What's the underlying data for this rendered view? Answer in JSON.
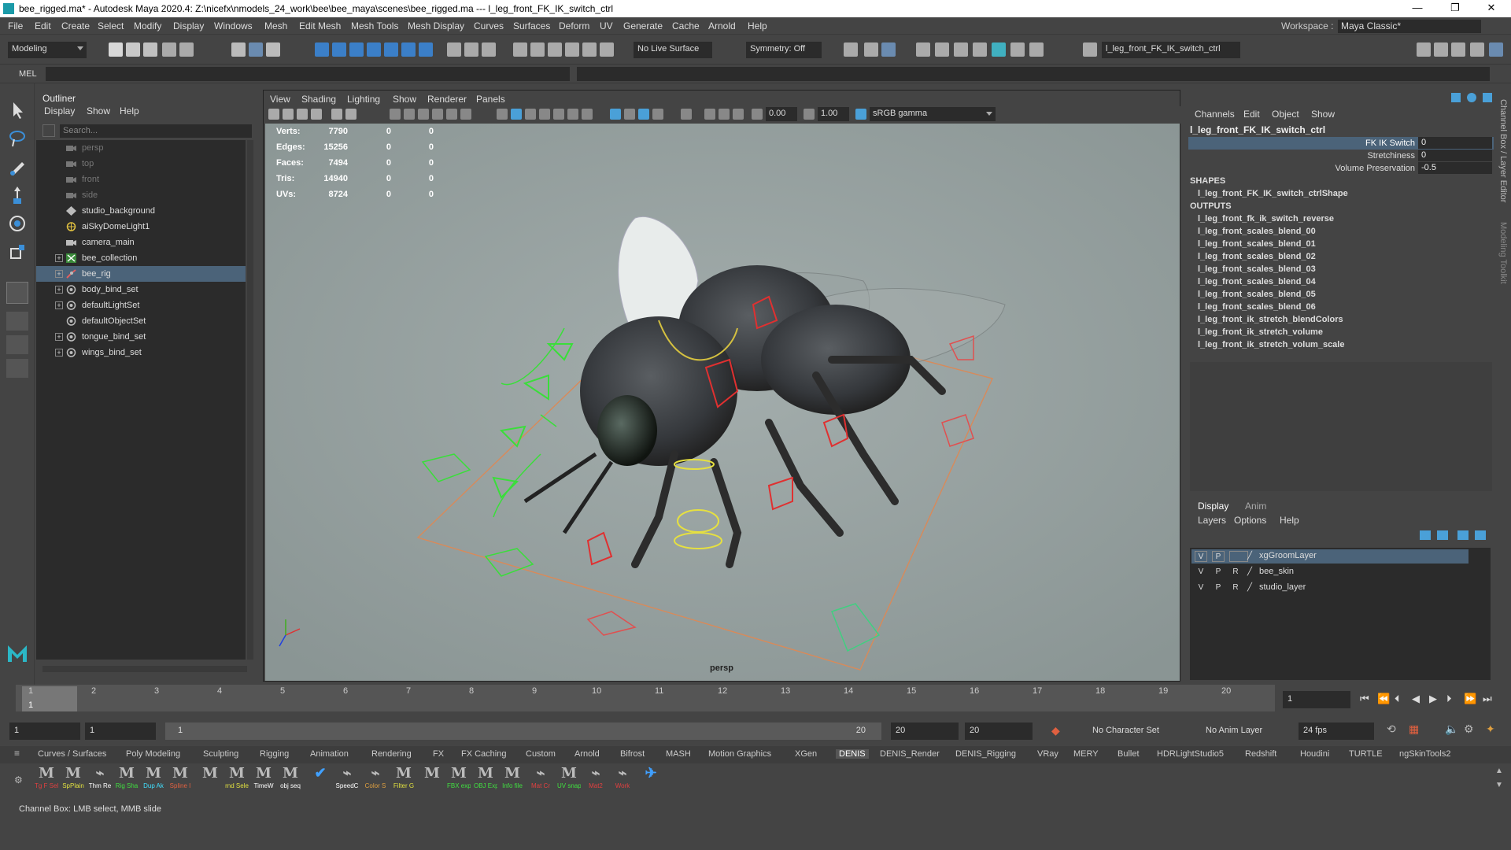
{
  "window": {
    "title": "bee_rigged.ma* - Autodesk Maya 2020.4: Z:\\nicefx\\nmodels_24_work\\bee\\bee_maya\\scenes\\bee_rigged.ma   ---   l_leg_front_FK_IK_switch_ctrl",
    "minimize": "—",
    "restore": "❐",
    "close": "✕"
  },
  "menubar": {
    "items": [
      "File",
      "Edit",
      "Create",
      "Select",
      "Modify",
      "Display",
      "Windows",
      "Mesh",
      "Edit Mesh",
      "Mesh Tools",
      "Mesh Display",
      "Curves",
      "Surfaces",
      "Deform",
      "UV",
      "Generate",
      "Cache",
      "Arnold",
      "Help"
    ],
    "workspace_label": "Workspace :",
    "workspace_value": "Maya Classic*"
  },
  "statusline": {
    "mode": "Modeling",
    "live_surface": "No Live Surface",
    "symmetry": "Symmetry: Off",
    "selected_object": "l_leg_front_FK_IK_switch_ctrl"
  },
  "commandline": {
    "label": "MEL"
  },
  "outliner": {
    "title": "Outliner",
    "menus": [
      "Display",
      "Show",
      "Help"
    ],
    "search_placeholder": "Search...",
    "items": [
      {
        "label": "persp",
        "kind": "camera",
        "expandable": false
      },
      {
        "label": "top",
        "kind": "camera",
        "expandable": false
      },
      {
        "label": "front",
        "kind": "camera",
        "expandable": false
      },
      {
        "label": "side",
        "kind": "camera",
        "expandable": false
      },
      {
        "label": "studio_background",
        "kind": "transform",
        "expandable": false
      },
      {
        "label": "aiSkyDomeLight1",
        "kind": "light",
        "expandable": false
      },
      {
        "label": "camera_main",
        "kind": "camera-main",
        "expandable": false
      },
      {
        "label": "bee_collection",
        "kind": "group",
        "expandable": true
      },
      {
        "label": "bee_rig",
        "kind": "rig",
        "expandable": true,
        "selected": true
      },
      {
        "label": "body_bind_set",
        "kind": "set",
        "expandable": true
      },
      {
        "label": "defaultLightSet",
        "kind": "set",
        "expandable": true
      },
      {
        "label": "defaultObjectSet",
        "kind": "set",
        "expandable": false
      },
      {
        "label": "tongue_bind_set",
        "kind": "set",
        "expandable": true
      },
      {
        "label": "wings_bind_set",
        "kind": "set",
        "expandable": true
      }
    ]
  },
  "viewport": {
    "menus": [
      "View",
      "Shading",
      "Lighting",
      "Show",
      "Renderer",
      "Panels"
    ],
    "exposure": "0.00",
    "gamma": "1.00",
    "color_space": "sRGB gamma",
    "camera_label": "persp",
    "stats": [
      {
        "label": "Verts:",
        "values": [
          "7790",
          "0",
          "0"
        ]
      },
      {
        "label": "Edges:",
        "values": [
          "15256",
          "0",
          "0"
        ]
      },
      {
        "label": "Faces:",
        "values": [
          "7494",
          "0",
          "0"
        ]
      },
      {
        "label": "Tris:",
        "values": [
          "14940",
          "0",
          "0"
        ]
      },
      {
        "label": "UVs:",
        "values": [
          "8724",
          "0",
          "0"
        ]
      }
    ]
  },
  "channelbox": {
    "menus": [
      "Channels",
      "Edit",
      "Object",
      "Show"
    ],
    "object": "l_leg_front_FK_IK_switch_ctrl",
    "attributes": [
      {
        "name": "FK IK Switch",
        "value": "0"
      },
      {
        "name": "Stretchiness",
        "value": "0"
      },
      {
        "name": "Volume Preservation",
        "value": "-0.5"
      }
    ],
    "shapes_header": "SHAPES",
    "shape": "l_leg_front_FK_IK_switch_ctrlShape",
    "outputs_header": "OUTPUTS",
    "outputs": [
      "l_leg_front_fk_ik_switch_reverse",
      "l_leg_front_scales_blend_00",
      "l_leg_front_scales_blend_01",
      "l_leg_front_scales_blend_02",
      "l_leg_front_scales_blend_03",
      "l_leg_front_scales_blend_04",
      "l_leg_front_scales_blend_05",
      "l_leg_front_scales_blend_06",
      "l_leg_front_ik_stretch_blendColors",
      "l_leg_front_ik_stretch_volume",
      "l_leg_front_ik_stretch_volum_scale"
    ]
  },
  "rightstrip": {
    "label1": "Channel Box / Layer Editor",
    "label2": "Modeling Toolkit"
  },
  "layers": {
    "tabs": [
      "Display",
      "Anim"
    ],
    "menus": [
      "Layers",
      "Options",
      "Help"
    ],
    "items": [
      {
        "v": "V",
        "p": "P",
        "r": "",
        "name": "xgGroomLayer",
        "selected": true
      },
      {
        "v": "V",
        "p": "P",
        "r": "R",
        "name": "bee_skin",
        "selected": false
      },
      {
        "v": "V",
        "p": "P",
        "r": "R",
        "name": "studio_layer",
        "selected": false
      }
    ]
  },
  "timeline": {
    "ticks": [
      "1",
      "2",
      "3",
      "4",
      "5",
      "6",
      "7",
      "8",
      "9",
      "10",
      "11",
      "12",
      "13",
      "14",
      "15",
      "16",
      "17",
      "18",
      "19",
      "20"
    ],
    "current_frame_label": "1",
    "current_frame_field": "1"
  },
  "range": {
    "start": "1",
    "playback_start": "1",
    "slider_start": "1",
    "slider_end": "20",
    "playback_end": "20",
    "end": "20",
    "character_set": "No Character Set",
    "anim_layer": "No Anim Layer",
    "fps": "24 fps"
  },
  "shelf": {
    "tabs": [
      "Curves / Surfaces",
      "Poly Modeling",
      "Sculpting",
      "Rigging",
      "Animation",
      "Rendering",
      "FX",
      "FX Caching",
      "Custom",
      "Arnold",
      "Bifrost",
      "MASH",
      "Motion Graphics",
      "XGen",
      "DENIS",
      "DENIS_Render",
      "DENIS_Rigging",
      "VRay",
      "MERY",
      "Bullet",
      "HDRLightStudio5",
      "Redshift",
      "Houdini",
      "TURTLE",
      "ngSkinTools2"
    ],
    "active_tab": "DENIS",
    "icons": [
      {
        "label": "Tg F Sel",
        "color": "#e04040"
      },
      {
        "label": "SpPlain",
        "color": "#e0e040"
      },
      {
        "label": "Thm Re",
        "color": "#ffffff"
      },
      {
        "label": "Rig Sha",
        "color": "#40e040"
      },
      {
        "label": "Dup Ak",
        "color": "#40e0ff"
      },
      {
        "label": "Spline I",
        "color": "#e06040"
      },
      {
        "label": "",
        "color": "#cccccc"
      },
      {
        "label": "rnd Sele",
        "color": "#e0e040"
      },
      {
        "label": "TimeW",
        "color": "#ffffff"
      },
      {
        "label": "obj seq",
        "color": "#ffffff"
      },
      {
        "label": "",
        "color": "#40a0ff"
      },
      {
        "label": "SpeedC",
        "color": "#ffffff"
      },
      {
        "label": "Color S",
        "color": "#e0a040"
      },
      {
        "label": "Filter G",
        "color": "#e0e040"
      },
      {
        "label": "",
        "color": "#cccccc"
      },
      {
        "label": "FBX exp",
        "color": "#40e040"
      },
      {
        "label": "OBJ Exp",
        "color": "#40e040"
      },
      {
        "label": "Info file",
        "color": "#40e040"
      },
      {
        "label": "Mat Cr",
        "color": "#e04040"
      },
      {
        "label": "UV snap",
        "color": "#40e040"
      },
      {
        "label": "Mat2",
        "color": "#e04040"
      },
      {
        "label": "Work",
        "color": "#e04040"
      },
      {
        "label": "",
        "color": "#cccccc"
      }
    ]
  },
  "helpline": {
    "text": "Channel Box: LMB select, MMB slide"
  }
}
